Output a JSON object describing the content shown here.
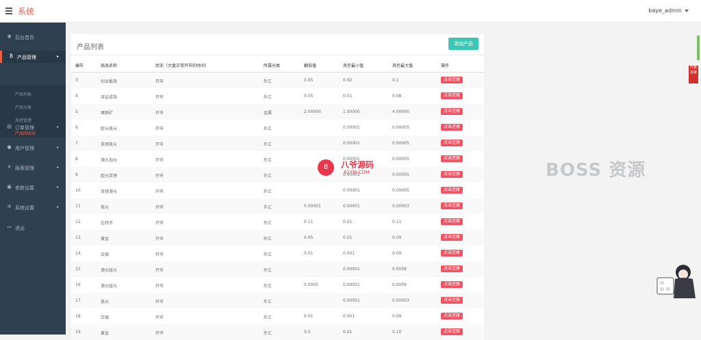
{
  "header": {
    "brand": "系统",
    "user": "baye_admin"
  },
  "sidebar": {
    "items": [
      {
        "icon": "dashboard-icon",
        "glyph": "◉",
        "label": "后台首页",
        "arrow": ""
      },
      {
        "icon": "bitcoin-icon",
        "glyph": "₿",
        "label": "产品管理",
        "arrow": "▸"
      },
      {
        "icon": "orders-icon",
        "glyph": "▤",
        "label": "订单管理",
        "arrow": "▸"
      },
      {
        "icon": "user-icon",
        "glyph": "●",
        "label": "用户管理",
        "arrow": "▸"
      },
      {
        "icon": "yen-icon",
        "glyph": "¥",
        "label": "报表管理",
        "arrow": "▸"
      },
      {
        "icon": "param-icon",
        "glyph": "▣",
        "label": "参数设置",
        "arrow": "▸"
      },
      {
        "icon": "cogs-icon",
        "glyph": "✲",
        "label": "系统设置",
        "arrow": "▸"
      },
      {
        "icon": "logout-icon",
        "glyph": "↦",
        "label": "退出",
        "arrow": ""
      }
    ],
    "subitems": [
      "产品列表",
      "产品分类",
      "风控管理",
      "产品回收站"
    ]
  },
  "panel": {
    "title": "产品列表",
    "add_button": "添加产品",
    "columns": [
      "编号",
      "商品名称",
      "状态（大盘正常开市的时间）",
      "所属分类",
      "翻倍值",
      "风控最小值",
      "风控最大值",
      "操作"
    ],
    "action_label": "点击还原",
    "rows": [
      [
        "3",
        "创业板指",
        "开市",
        "外汇",
        "0.05",
        "0.02",
        "0.1"
      ],
      [
        "4",
        "深证成指",
        "开市",
        "外汇",
        "0.05",
        "0.01",
        "0.08"
      ],
      [
        "5",
        "赌铜矿",
        "开市",
        "金属",
        "2.00000",
        "1.00000",
        "4.00000"
      ],
      [
        "6",
        "欧元美元",
        "开市",
        "外汇",
        "",
        "0.00001",
        "0.00005"
      ],
      [
        "7",
        "英镑美元",
        "开市",
        "外汇",
        "",
        "0.00001",
        "0.00005"
      ],
      [
        "8",
        "澳元加元",
        "开市",
        "外汇",
        "",
        "0.00001",
        "0.00005"
      ],
      [
        "9",
        "欧元英镑",
        "开市",
        "外汇",
        "",
        "0.00001",
        "0.00005"
      ],
      [
        "10",
        "英镑澳元",
        "开市",
        "外汇",
        "",
        "0.00001",
        "0.00005"
      ],
      [
        "11",
        "美元",
        "开市",
        "外汇",
        "0.00001",
        "0.00001",
        "0.00003"
      ],
      [
        "12",
        "比特币",
        "开市",
        "外汇",
        "0.11",
        "0.01",
        "0.11"
      ],
      [
        "13",
        "黄金",
        "开市",
        "外汇",
        "0.05",
        "0.01",
        "0.09"
      ],
      [
        "14",
        "白银",
        "开市",
        "外汇",
        "0.01",
        "0.001",
        "0.09"
      ],
      [
        "15",
        "澳元纽元",
        "开市",
        "外汇",
        "",
        "0.00001",
        "0.0009"
      ],
      [
        "16",
        "澳元纽元",
        "开市",
        "外汇",
        "0.0005",
        "0.00001",
        "0.0009"
      ],
      [
        "17",
        "美元",
        "开市",
        "外汇",
        "",
        "0.00001",
        "0.00003"
      ],
      [
        "18",
        "白银",
        "开市",
        "外汇",
        "0.01",
        "0.001",
        "0.09"
      ],
      [
        "19",
        "黄金",
        "开市",
        "外汇",
        "0.5",
        "0.01",
        "0.10"
      ]
    ]
  },
  "watermarks": {
    "logo_glyph": "8",
    "cn": "八爷源码",
    "en": "81YM.COM",
    "boss": "BOSS 资源"
  },
  "floating": {
    "side_tab": "升级加速"
  },
  "colors": {
    "accent": "#e8604c",
    "sidebar_bg": "#2f4050",
    "add_button": "#3cc7b4",
    "restore_button": "#ed5565"
  }
}
